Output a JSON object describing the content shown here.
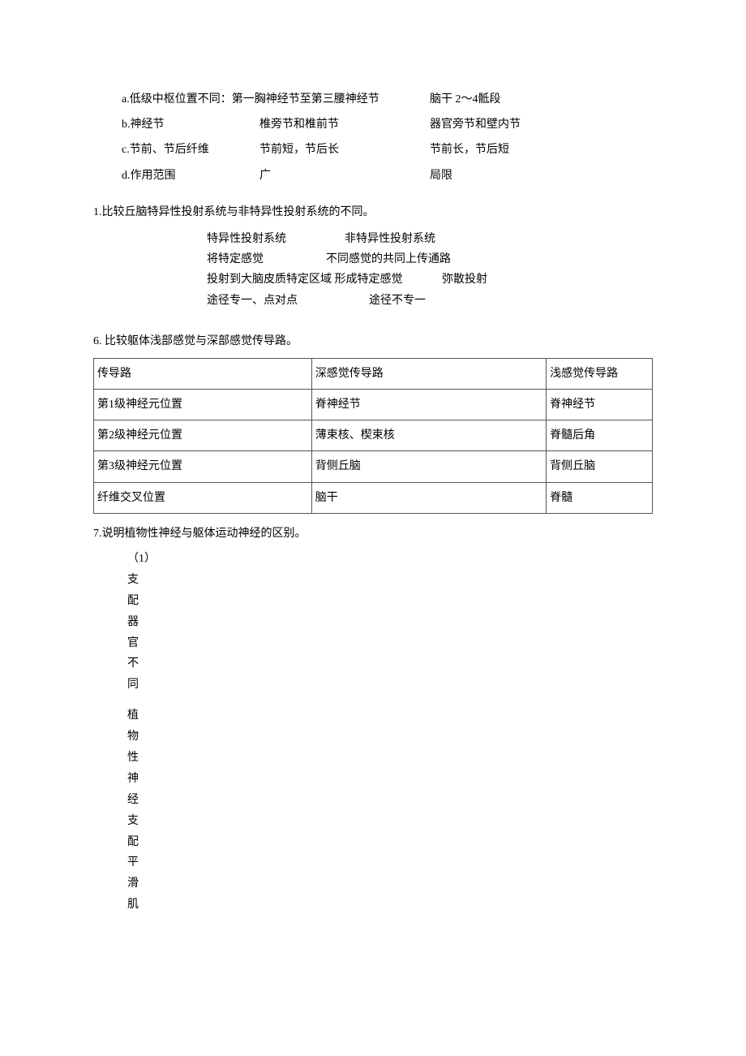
{
  "section_abcd": [
    {
      "label": "a.低级中枢位置不同：",
      "c2": "第一胸神经节至第三腰神经节",
      "c3": "脑干 2～4骶段"
    },
    {
      "label": "b.神经节",
      "c2": "椎旁节和椎前节",
      "c3": "器官旁节和壁内节"
    },
    {
      "label": "c.节前、节后纤维",
      "c2": "节前短，节后长",
      "c3": "节前长，节后短"
    },
    {
      "label": "d.作用范围",
      "c2": "广",
      "c3": "局限"
    }
  ],
  "q1": {
    "heading": "1.比较丘脑特异性投射系统与非特异性投射系统的不同。",
    "rows": [
      {
        "c1": "特异性投射系统",
        "c2": "非特异性投射系统"
      },
      {
        "c1": "将特定感觉",
        "c2": "不同感觉的共同上传通路"
      },
      {
        "c1": "投射到大脑皮质特定区域 形成特定感觉",
        "c2": "弥散投射"
      },
      {
        "c1": "途径专一、点对点",
        "c2": "途径不专一"
      }
    ]
  },
  "q6": {
    "heading": "6. 比较躯体浅部感觉与深部感觉传导路。",
    "rows": [
      {
        "c1": "传导路",
        "c2": "深感觉传导路",
        "c3": "浅感觉传导路"
      },
      {
        "c1": "第1级神经元位置",
        "c2": "脊神经节",
        "c3": "脊神经节"
      },
      {
        "c1": "第2级神经元位置",
        "c2": "薄束核、楔束核",
        "c3": "脊髓后角"
      },
      {
        "c1": "第3级神经元位置",
        "c2": "背侧丘脑",
        "c3": "背侧丘脑"
      },
      {
        "c1": "纤维交叉位置",
        "c2": "脑干",
        "c3": "脊髓"
      }
    ]
  },
  "q7": {
    "heading": "7.说明植物性神经与躯体运动神经的区别。",
    "vertical1": "（1）支配器官不同",
    "vertical2": "植物性神经支配平滑肌"
  }
}
